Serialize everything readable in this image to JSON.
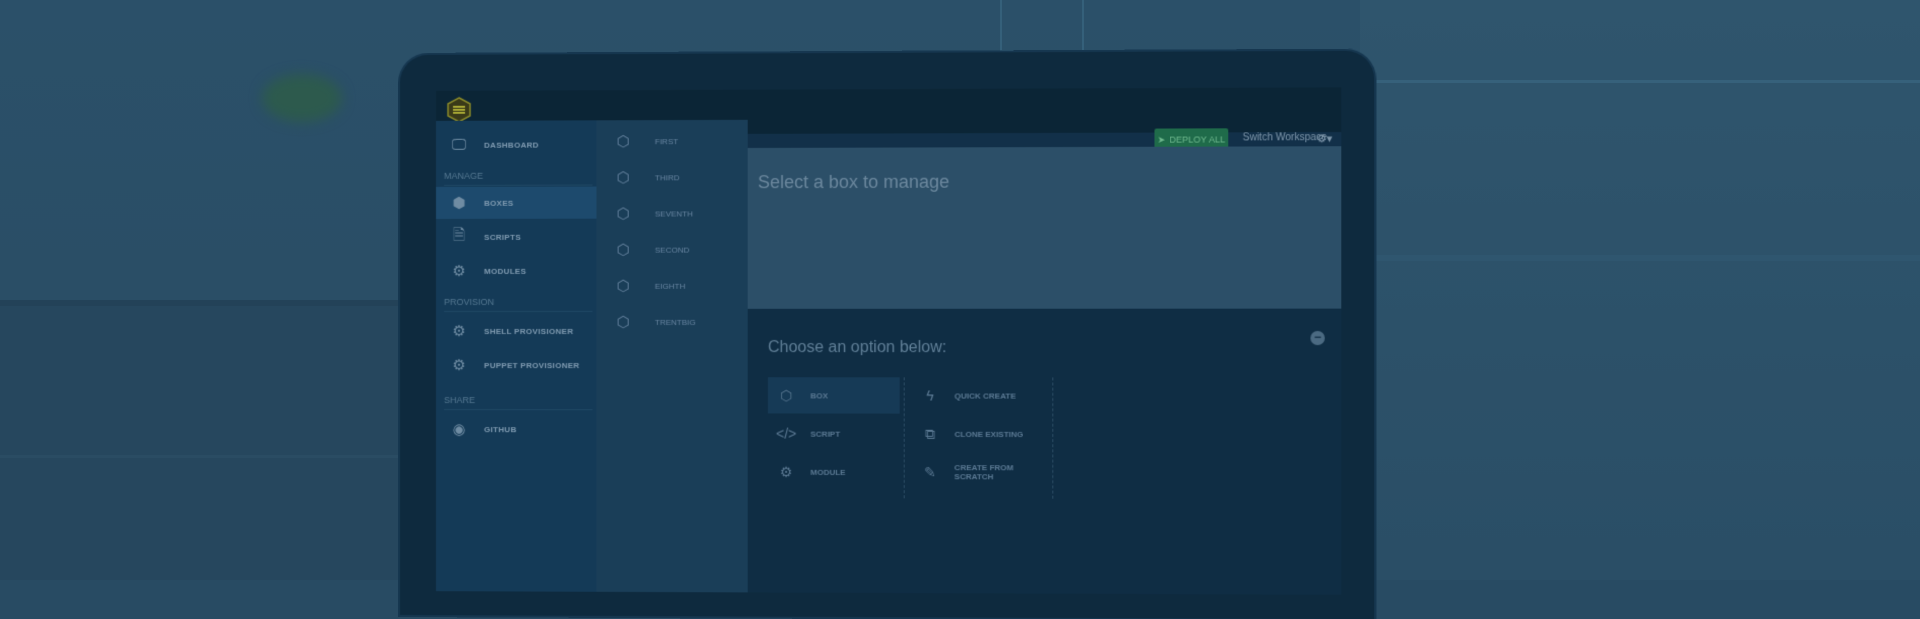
{
  "topbar": {
    "deploy_label": "DEPLOY ALL",
    "switch_label": "Switch Workspace"
  },
  "sidebar": {
    "dashboard": "DASHBOARD",
    "manage_heading": "MANAGE",
    "boxes": "BOXES",
    "scripts": "SCRIPTS",
    "modules": "MODULES",
    "provision_heading": "PROVISION",
    "shell": "SHELL PROVISIONER",
    "puppet": "PUPPET PROVISIONER",
    "share_heading": "SHARE",
    "github": "GITHUB"
  },
  "boxes": [
    "FIRST",
    "THIRD",
    "SEVENTH",
    "SECOND",
    "EIGHTH",
    "TRENTBIG"
  ],
  "main": {
    "manage_title": "Select a box to manage",
    "choose_title": "Choose an option below:"
  },
  "options": {
    "left": [
      "BOX",
      "SCRIPT",
      "MODULE"
    ],
    "right": [
      "QUICK CREATE",
      "CLONE EXISTING",
      "CREATE FROM SCRATCH"
    ]
  }
}
